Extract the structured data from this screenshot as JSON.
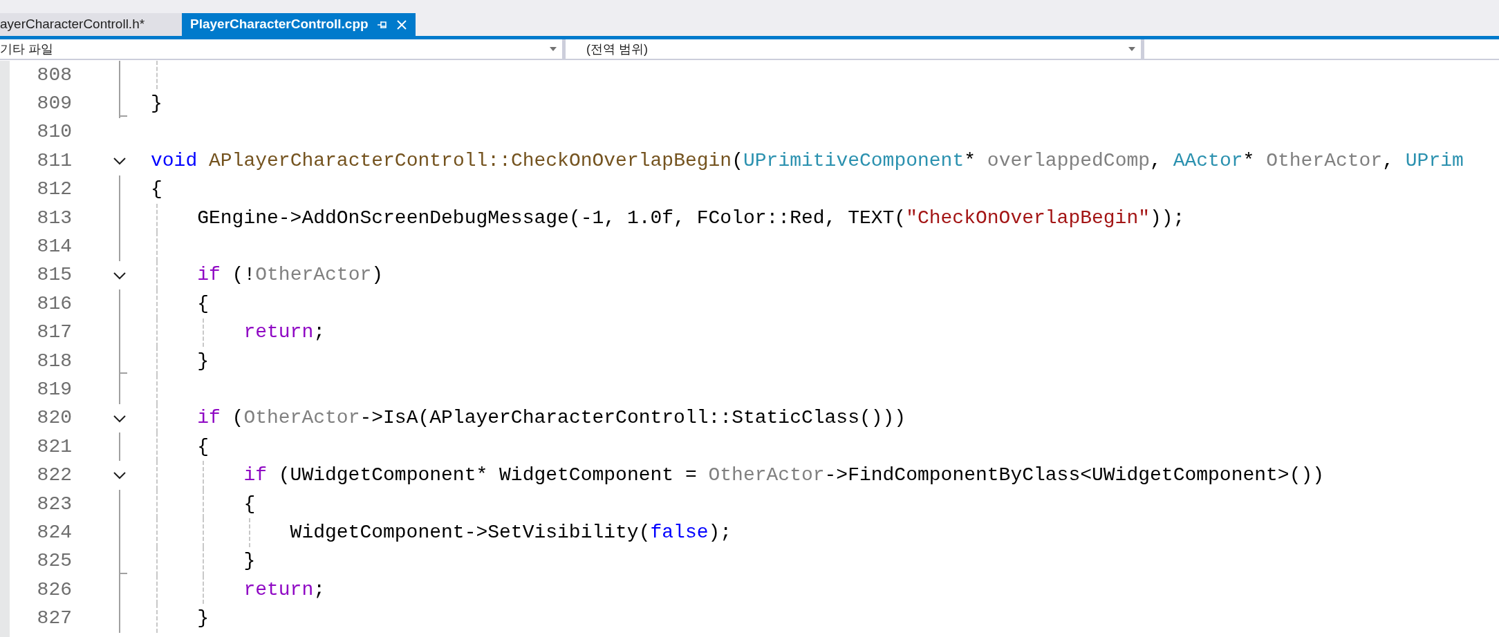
{
  "tabs": [
    {
      "label": "ayerCharacterControll.h*",
      "selected": false
    },
    {
      "label": "PlayerCharacterControll.cpp",
      "selected": true
    }
  ],
  "nav_bar": {
    "file_scope": "기타 파일",
    "member_scope": "(전역 범위)"
  },
  "lines": [
    {
      "number": "808",
      "collapsible": false,
      "in_fold": true,
      "fold_end": false,
      "guides": [
        true
      ]
    },
    {
      "number": "809",
      "collapsible": false,
      "in_fold": true,
      "fold_end": true,
      "tokens": [
        {
          "kind": "plain",
          "text": "}"
        }
      ]
    },
    {
      "number": "810",
      "collapsible": false,
      "in_fold": false,
      "fold_end": false
    },
    {
      "number": "811",
      "collapsible": true,
      "in_fold": false,
      "fold_end": false,
      "tokens": [
        {
          "kind": "keyword",
          "text": "void"
        },
        {
          "kind": "function",
          "text": " APlayerCharacterControll::CheckOnOverlapBegin"
        },
        {
          "kind": "plain",
          "text": "("
        },
        {
          "kind": "type",
          "text": "UPrimitiveComponent"
        },
        {
          "kind": "plain",
          "text": "* "
        },
        {
          "kind": "param",
          "text": "overlappedComp"
        },
        {
          "kind": "plain",
          "text": ", "
        },
        {
          "kind": "type",
          "text": "AActor"
        },
        {
          "kind": "plain",
          "text": "* "
        },
        {
          "kind": "param",
          "text": "OtherActor"
        },
        {
          "kind": "plain",
          "text": ", "
        },
        {
          "kind": "type",
          "text": "UPrim"
        }
      ]
    },
    {
      "number": "812",
      "collapsible": false,
      "in_fold": true,
      "fold_end": false,
      "tokens": [
        {
          "kind": "plain",
          "text": "{"
        }
      ]
    },
    {
      "number": "813",
      "collapsible": false,
      "in_fold": true,
      "fold_end": false,
      "guides": [
        true
      ],
      "tokens": [
        {
          "kind": "plain",
          "text": "GEngine->AddOnScreenDebugMessage(-1, 1.0f, FColor::Red, TEXT("
        },
        {
          "kind": "string",
          "text": "\"CheckOnOverlapBegin\""
        },
        {
          "kind": "plain",
          "text": "));"
        }
      ]
    },
    {
      "number": "814",
      "collapsible": false,
      "in_fold": true,
      "fold_end": false,
      "guides": [
        true
      ]
    },
    {
      "number": "815",
      "collapsible": true,
      "in_fold": false,
      "fold_end": false,
      "guides": [
        true
      ],
      "tokens": [
        {
          "kind": "control",
          "text": "if"
        },
        {
          "kind": "plain",
          "text": " (!"
        },
        {
          "kind": "param",
          "text": "OtherActor"
        },
        {
          "kind": "plain",
          "text": ")"
        }
      ]
    },
    {
      "number": "816",
      "collapsible": false,
      "in_fold": true,
      "fold_end": false,
      "guides": [
        true
      ],
      "tokens": [
        {
          "kind": "plain",
          "text": "{"
        }
      ]
    },
    {
      "number": "817",
      "collapsible": false,
      "in_fold": true,
      "fold_end": false,
      "guides": [
        true,
        true
      ],
      "tokens": [
        {
          "kind": "control",
          "text": "return"
        },
        {
          "kind": "plain",
          "text": ";"
        }
      ]
    },
    {
      "number": "818",
      "collapsible": false,
      "in_fold": true,
      "fold_end": true,
      "guides": [
        true
      ],
      "tokens": [
        {
          "kind": "plain",
          "text": "}"
        }
      ]
    },
    {
      "number": "819",
      "collapsible": false,
      "in_fold": true,
      "fold_end": false,
      "guides": [
        true
      ]
    },
    {
      "number": "820",
      "collapsible": true,
      "in_fold": false,
      "fold_end": false,
      "guides": [
        true
      ],
      "tokens": [
        {
          "kind": "control",
          "text": "if"
        },
        {
          "kind": "plain",
          "text": " ("
        },
        {
          "kind": "param",
          "text": "OtherActor"
        },
        {
          "kind": "plain",
          "text": "->IsA(APlayerCharacterControll::StaticClass()))"
        }
      ]
    },
    {
      "number": "821",
      "collapsible": false,
      "in_fold": true,
      "fold_end": false,
      "guides": [
        true
      ],
      "tokens": [
        {
          "kind": "plain",
          "text": "{"
        }
      ]
    },
    {
      "number": "822",
      "collapsible": true,
      "in_fold": false,
      "fold_end": false,
      "guides": [
        true,
        true
      ],
      "tokens": [
        {
          "kind": "control",
          "text": "if"
        },
        {
          "kind": "plain",
          "text": " (UWidgetComponent* WidgetComponent = "
        },
        {
          "kind": "param",
          "text": "OtherActor"
        },
        {
          "kind": "plain",
          "text": "->FindComponentByClass<UWidgetComponent>())"
        }
      ]
    },
    {
      "number": "823",
      "collapsible": false,
      "in_fold": true,
      "fold_end": false,
      "guides": [
        true,
        true
      ],
      "tokens": [
        {
          "kind": "plain",
          "text": "{"
        }
      ]
    },
    {
      "number": "824",
      "collapsible": false,
      "in_fold": true,
      "fold_end": false,
      "guides": [
        true,
        true,
        true
      ],
      "tokens": [
        {
          "kind": "plain",
          "text": "WidgetComponent->SetVisibility("
        },
        {
          "kind": "keyword",
          "text": "false"
        },
        {
          "kind": "plain",
          "text": ");"
        }
      ]
    },
    {
      "number": "825",
      "collapsible": false,
      "in_fold": true,
      "fold_end": true,
      "guides": [
        true,
        true
      ],
      "tokens": [
        {
          "kind": "plain",
          "text": "}"
        }
      ]
    },
    {
      "number": "826",
      "collapsible": false,
      "in_fold": true,
      "fold_end": false,
      "guides": [
        true,
        true
      ],
      "tokens": [
        {
          "kind": "control",
          "text": "return"
        },
        {
          "kind": "plain",
          "text": ";"
        }
      ]
    },
    {
      "number": "827",
      "collapsible": false,
      "in_fold": true,
      "fold_end": false,
      "guides": [
        true
      ],
      "tokens": [
        {
          "kind": "plain",
          "text": "}"
        }
      ]
    }
  ]
}
